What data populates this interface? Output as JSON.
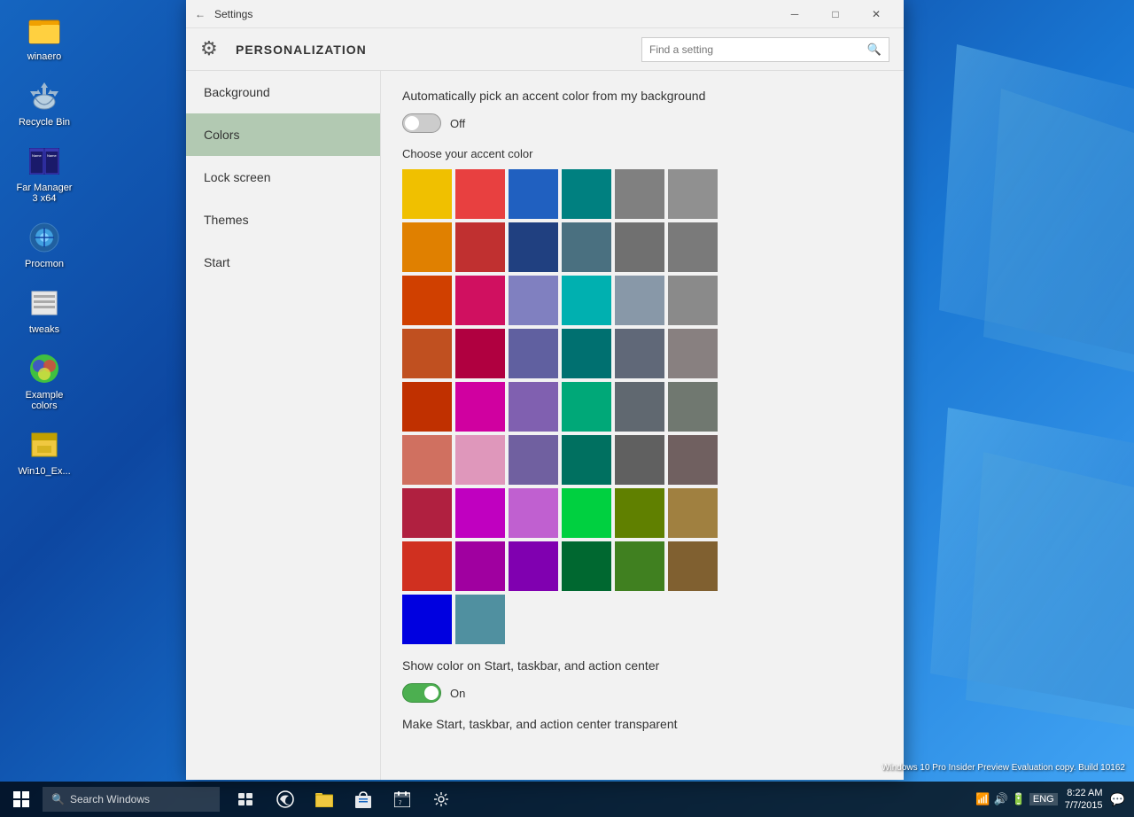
{
  "window": {
    "title": "Settings",
    "minimize": "─",
    "maximize": "□",
    "close": "✕"
  },
  "header": {
    "icon": "⚙",
    "title": "PERSONALIZATION",
    "search_placeholder": "Find a setting"
  },
  "sidebar": {
    "items": [
      {
        "label": "Background",
        "id": "background",
        "active": false
      },
      {
        "label": "Colors",
        "id": "colors",
        "active": true
      },
      {
        "label": "Lock screen",
        "id": "lock-screen",
        "active": false
      },
      {
        "label": "Themes",
        "id": "themes",
        "active": false
      },
      {
        "label": "Start",
        "id": "start",
        "active": false
      }
    ]
  },
  "main": {
    "auto_accent_label": "Automatically pick an accent color from my background",
    "auto_accent_toggle": "Off",
    "auto_accent_state": "off",
    "choose_label": "Choose your accent color",
    "colors": [
      "#f0c000",
      "#e84040",
      "#2060c0",
      "#008080",
      "#808080",
      "#909090",
      "#e08000",
      "#c03030",
      "#204080",
      "#4a7080",
      "#707070",
      "#7a7a7a",
      "#d04000",
      "#d01060",
      "#8080c0",
      "#00b0b0",
      "#8898a8",
      "#8a8a8a",
      "#c05020",
      "#b00040",
      "#6060a0",
      "#007070",
      "#606878",
      "#888080",
      "#c03000",
      "#d000a0",
      "#8060b0",
      "#00a878",
      "#606870",
      "#707870",
      "#d07060",
      "#c0006060",
      "#7060a0",
      "#007060",
      "#606060",
      "#706060",
      "#b02040",
      "#c000c0",
      "#c060d0",
      "#00d040",
      "#608000",
      "#a08040",
      "#d03020",
      "#a000a0",
      "#8000b0",
      "#006830",
      "#408020",
      "#806030",
      "#0000e0",
      "#5090a0"
    ],
    "show_color_label": "Show color on Start, taskbar, and action center",
    "show_color_toggle": "On",
    "show_color_state": "on",
    "transparent_label": "Make Start, taskbar, and action center transparent"
  },
  "taskbar": {
    "search_placeholder": "Search Windows",
    "time": "8:22 AM",
    "date": "7/7/2015",
    "system_info": "Windows 10 Pro Insider Preview\nEvaluation copy. Build 10162"
  },
  "desktop_icons": [
    {
      "label": "winaero",
      "icon": "folder"
    },
    {
      "label": "Recycle Bin",
      "icon": "recycle"
    },
    {
      "label": "Far Manager\n3 x64",
      "icon": "far-manager"
    },
    {
      "label": "Procmon",
      "icon": "procmon"
    },
    {
      "label": "tweaks",
      "icon": "tweaks"
    },
    {
      "label": "Example\ncolors",
      "icon": "colors"
    },
    {
      "label": "Win10_Ex...",
      "icon": "archive"
    }
  ]
}
